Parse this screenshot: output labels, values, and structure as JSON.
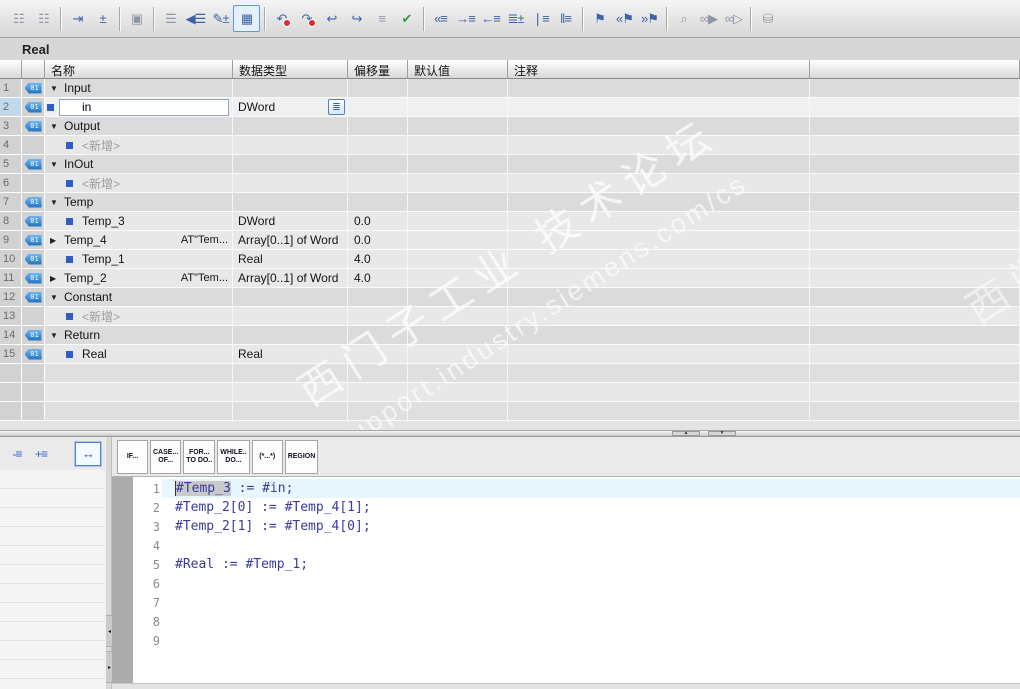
{
  "window": {
    "title": "Real"
  },
  "toolbar": {
    "icons": [
      {
        "name": "insert-network-icon",
        "glyph": "☷",
        "cls": "dim"
      },
      {
        "name": "insert-empty-box-icon",
        "glyph": "☷",
        "cls": "dim"
      },
      {
        "sep": true
      },
      {
        "name": "open-block-icon",
        "glyph": "⇥",
        "cls": ""
      },
      {
        "name": "insert-row-icon",
        "glyph": "±",
        "cls": ""
      },
      {
        "sep": true
      },
      {
        "name": "undo-capsule-icon",
        "glyph": "▣",
        "cls": "dim"
      },
      {
        "sep": true
      },
      {
        "name": "network-overview-icon",
        "glyph": "☰",
        "cls": "dim"
      },
      {
        "name": "goto-network-icon",
        "glyph": "◀☰",
        "cls": ""
      },
      {
        "name": "insert-comment-icon",
        "glyph": "✎±",
        "cls": ""
      },
      {
        "name": "favorites-icon",
        "glyph": "▦",
        "cls": "boxed"
      },
      {
        "sep": true
      },
      {
        "name": "undo-icon",
        "glyph": "↶",
        "cls": "",
        "dot": true
      },
      {
        "name": "redo-icon",
        "glyph": "↷",
        "cls": "",
        "dot": true
      },
      {
        "name": "snippet-back-icon",
        "glyph": "↩",
        "cls": ""
      },
      {
        "name": "snippet-forward-icon",
        "glyph": "↪",
        "cls": ""
      },
      {
        "name": "align-text-icon",
        "glyph": "≡",
        "cls": "dim"
      },
      {
        "name": "syntax-check-icon",
        "glyph": "✔",
        "cls": "green"
      },
      {
        "sep": true
      },
      {
        "name": "goto-previous-icon",
        "glyph": "«≡",
        "cls": ""
      },
      {
        "name": "indent-icon",
        "glyph": "→≡",
        "cls": ""
      },
      {
        "name": "outdent-icon",
        "glyph": "←≡",
        "cls": ""
      },
      {
        "name": "renumber-icon",
        "glyph": "≣±",
        "cls": ""
      },
      {
        "name": "absolute-operands-icon",
        "glyph": "❘≡",
        "cls": ""
      },
      {
        "name": "highlight-operands-icon",
        "glyph": "‖≡",
        "cls": ""
      },
      {
        "sep": true
      },
      {
        "name": "new-bookmark-icon",
        "glyph": "⚑",
        "cls": ""
      },
      {
        "name": "previous-bookmark-icon",
        "glyph": "«⚑",
        "cls": ""
      },
      {
        "name": "next-bookmark-icon",
        "glyph": "»⚑",
        "cls": ""
      },
      {
        "sep": true
      },
      {
        "name": "find-replace-icon",
        "glyph": "⌕",
        "cls": "dim"
      },
      {
        "name": "monitor-on-icon",
        "glyph": "∞▶",
        "cls": "dim"
      },
      {
        "name": "monitor-skip-icon",
        "glyph": "∞▷",
        "cls": "dim"
      },
      {
        "sep": true
      },
      {
        "name": "data-block-lock-icon",
        "glyph": "⛁",
        "cls": "dim"
      }
    ]
  },
  "icons": {
    "expand_open": "▼",
    "expand_closed": "▶",
    "dropdown_list": "≣",
    "tag_label": "01",
    "splitter_up": "▲",
    "splitter_down": "▼",
    "vsplit_left": "◂",
    "vsplit_right": "▸",
    "collapse_all": "-≡",
    "expand_all": "+≡",
    "absolute_toggle": "↔"
  },
  "table": {
    "headers": [
      "名称",
      "数据类型",
      "偏移量",
      "默认值",
      "注释"
    ],
    "rows": [
      {
        "num": "1",
        "cls": "sec",
        "icon": true,
        "expander": "open",
        "name": "Input"
      },
      {
        "num": "2",
        "cls": "selr",
        "icon": true,
        "editing": true,
        "name": "in",
        "type": "DWord",
        "type_dropdown": true,
        "selected": true
      },
      {
        "num": "3",
        "cls": "sec",
        "icon": true,
        "expander": "open",
        "name": "Output"
      },
      {
        "num": "4",
        "cls": "itm",
        "icon": false,
        "bullet": true,
        "placeholder": true,
        "name": "<新增>"
      },
      {
        "num": "5",
        "cls": "sec",
        "icon": true,
        "expander": "open",
        "name": "InOut"
      },
      {
        "num": "6",
        "cls": "itm",
        "icon": false,
        "bullet": true,
        "placeholder": true,
        "name": "<新增>"
      },
      {
        "num": "7",
        "cls": "sec",
        "icon": true,
        "expander": "open",
        "name": "Temp"
      },
      {
        "num": "8",
        "cls": "itm",
        "icon": true,
        "bullet": true,
        "name": "Temp_3",
        "type": "DWord",
        "offset": "0.0"
      },
      {
        "num": "9",
        "cls": "itm",
        "icon": true,
        "expander": "closed",
        "name": "Temp_4",
        "at": "AT\"Tem...",
        "type": "Array[0..1] of Word",
        "offset": "0.0"
      },
      {
        "num": "10",
        "cls": "itm",
        "icon": true,
        "bullet": true,
        "name": "Temp_1",
        "type": "Real",
        "offset": "4.0"
      },
      {
        "num": "11",
        "cls": "itm",
        "icon": true,
        "expander": "closed",
        "name": "Temp_2",
        "at": "AT\"Tem...",
        "type": "Array[0..1] of Word",
        "offset": "4.0"
      },
      {
        "num": "12",
        "cls": "sec",
        "icon": true,
        "expander": "open",
        "name": "Constant"
      },
      {
        "num": "13",
        "cls": "itm",
        "icon": false,
        "bullet": true,
        "placeholder": true,
        "name": "<新增>"
      },
      {
        "num": "14",
        "cls": "sec",
        "icon": true,
        "expander": "open",
        "name": "Return"
      },
      {
        "num": "15",
        "cls": "itm",
        "icon": true,
        "bullet": true,
        "name": "Real",
        "type": "Real"
      },
      {
        "num": "",
        "cls": "e1",
        "empty": true
      },
      {
        "num": "",
        "cls": "e2",
        "empty": true
      },
      {
        "num": "",
        "cls": "e1",
        "empty": true
      }
    ]
  },
  "watermark": {
    "line1": "西门子工业 技术论坛",
    "line2": "support.industry.siemens.com/cs",
    "fragment": "西门子工业"
  },
  "bottom": {
    "left_toolbar": [
      {
        "name": "collapse-all-icon",
        "key": "collapse_all",
        "boxed": false
      },
      {
        "name": "expand-all-icon",
        "key": "expand_all",
        "boxed": false
      },
      {
        "name": "absolute-operands-toggle-icon",
        "key": "absolute_toggle",
        "boxed": true
      }
    ]
  },
  "code": {
    "buttons": [
      {
        "top": "IF...",
        "bottom": ""
      },
      {
        "top": "CASE...",
        "bottom": "OF..."
      },
      {
        "top": "FOR...",
        "bottom": "TO DO.."
      },
      {
        "top": "WHILE..",
        "bottom": "DO..."
      },
      {
        "top": "(*...*)",
        "bottom": ""
      },
      {
        "top": "REGION",
        "bottom": ""
      }
    ],
    "lines": [
      {
        "num": "1",
        "sel": "#Temp_3",
        "post": " := #in;",
        "highlight": true
      },
      {
        "num": "2",
        "text": "#Temp_2[0] := #Temp_4[1];"
      },
      {
        "num": "3",
        "text": "#Temp_2[1] := #Temp_4[0];"
      },
      {
        "num": "4",
        "text": ""
      },
      {
        "num": "5",
        "text": "#Real := #Temp_1;"
      },
      {
        "num": "6",
        "text": ""
      },
      {
        "num": "7",
        "text": ""
      },
      {
        "num": "8",
        "text": ""
      },
      {
        "num": "9",
        "text": ""
      }
    ]
  }
}
